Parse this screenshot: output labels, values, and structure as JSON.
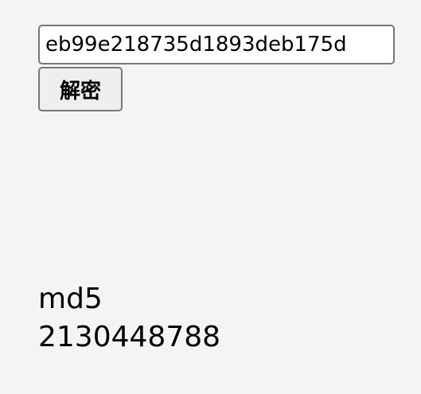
{
  "form": {
    "hash_value": "eb99e218735d1893deb175d",
    "decrypt_label": "解密"
  },
  "result": {
    "type_label": "md5",
    "plaintext": "2130448788"
  }
}
